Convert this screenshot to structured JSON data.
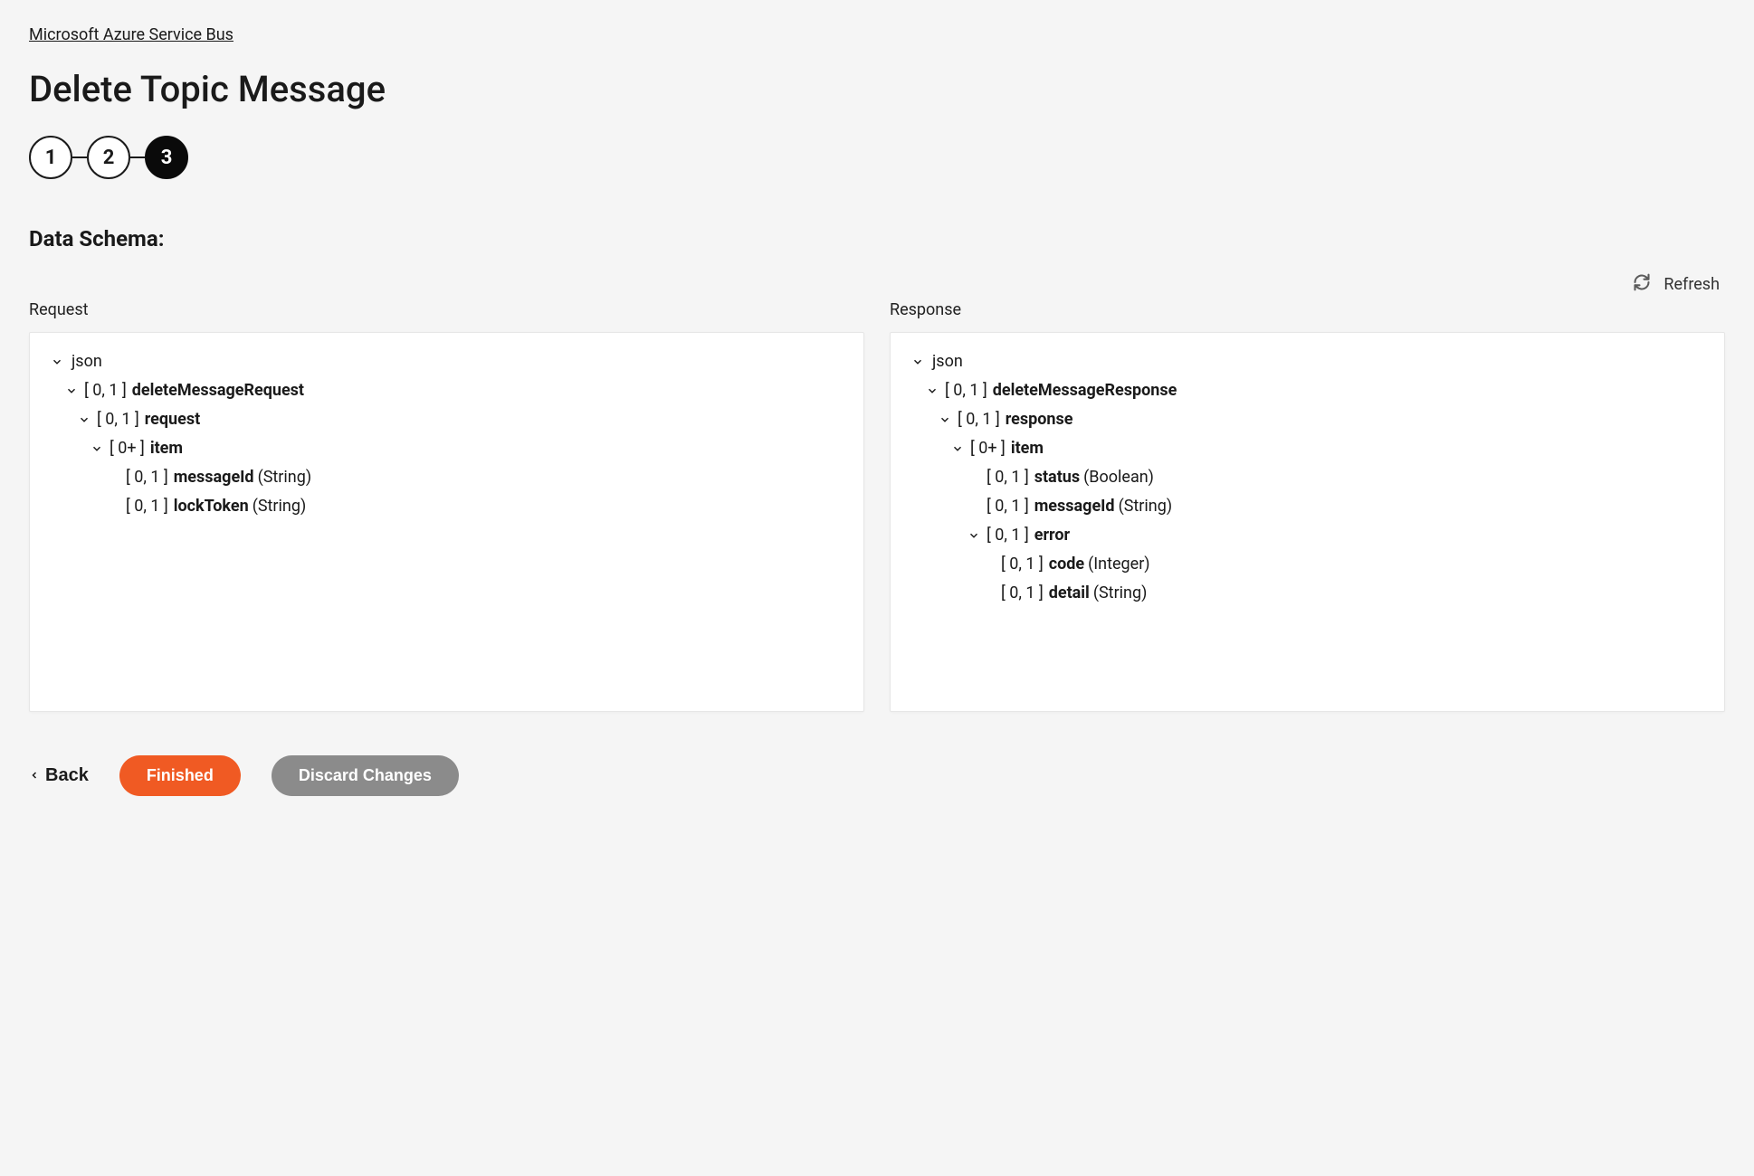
{
  "breadcrumb": {
    "label": "Microsoft Azure Service Bus"
  },
  "page": {
    "title": "Delete Topic Message"
  },
  "stepper": {
    "steps": [
      "1",
      "2",
      "3"
    ],
    "active_index": 2
  },
  "section": {
    "title": "Data Schema:"
  },
  "refresh": {
    "label": "Refresh"
  },
  "columns": {
    "request": {
      "header": "Request"
    },
    "response": {
      "header": "Response"
    }
  },
  "schema": {
    "root_name": "json",
    "request": {
      "root": {
        "occur": "[ 0, 1 ]",
        "name": "deleteMessageRequest",
        "children": {
          "request": {
            "occur": "[ 0, 1 ]",
            "name": "request",
            "children": {
              "item": {
                "occur": "[ 0+ ]",
                "name": "item",
                "fields": [
                  {
                    "occur": "[ 0, 1 ]",
                    "name": "messageId",
                    "type": "(String)"
                  },
                  {
                    "occur": "[ 0, 1 ]",
                    "name": "lockToken",
                    "type": "(String)"
                  }
                ]
              }
            }
          }
        }
      }
    },
    "response": {
      "root": {
        "occur": "[ 0, 1 ]",
        "name": "deleteMessageResponse",
        "children": {
          "response": {
            "occur": "[ 0, 1 ]",
            "name": "response",
            "children": {
              "item": {
                "occur": "[ 0+ ]",
                "name": "item",
                "fields": [
                  {
                    "occur": "[ 0, 1 ]",
                    "name": "status",
                    "type": "(Boolean)"
                  },
                  {
                    "occur": "[ 0, 1 ]",
                    "name": "messageId",
                    "type": "(String)"
                  }
                ],
                "children": {
                  "error": {
                    "occur": "[ 0, 1 ]",
                    "name": "error",
                    "fields": [
                      {
                        "occur": "[ 0, 1 ]",
                        "name": "code",
                        "type": "(Integer)"
                      },
                      {
                        "occur": "[ 0, 1 ]",
                        "name": "detail",
                        "type": "(String)"
                      }
                    ]
                  }
                }
              }
            }
          }
        }
      }
    }
  },
  "footer": {
    "back": "Back",
    "finished": "Finished",
    "discard": "Discard Changes"
  }
}
